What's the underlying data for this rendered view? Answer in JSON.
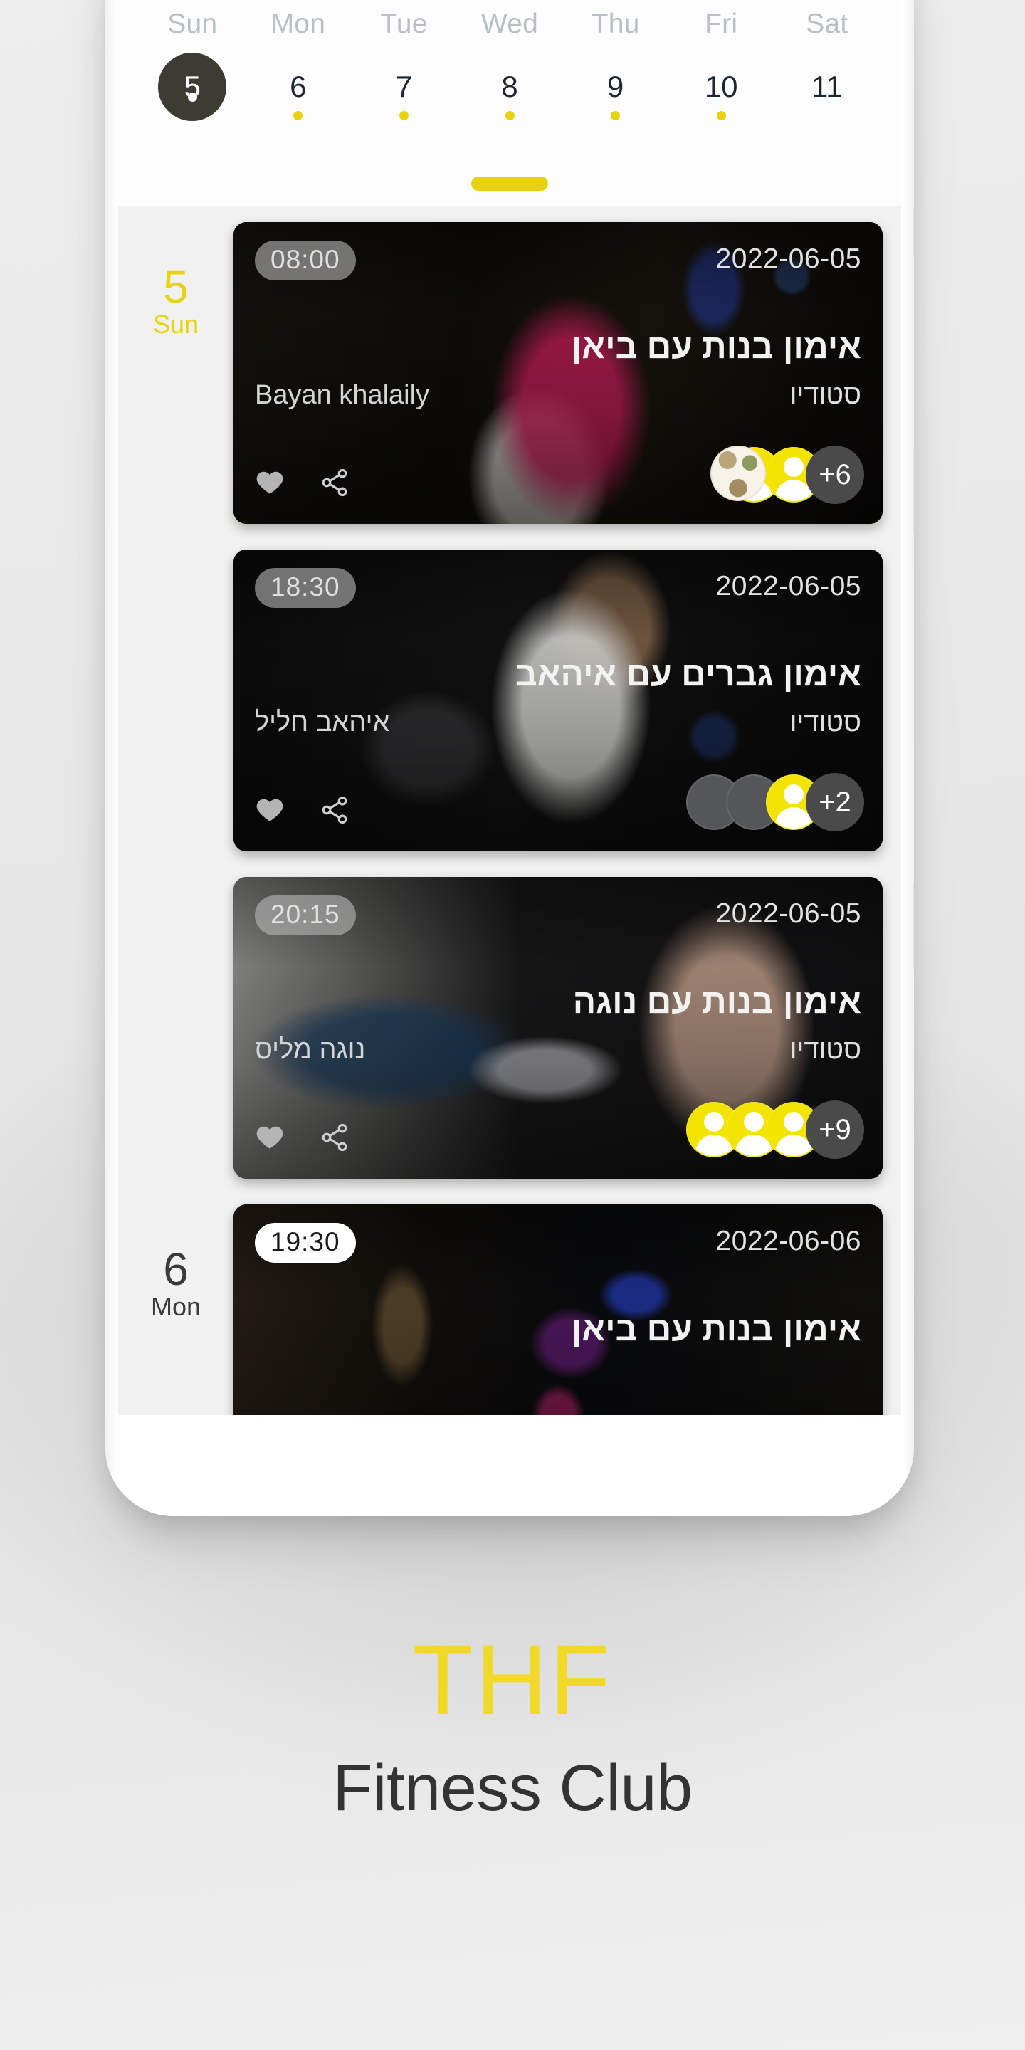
{
  "brand": {
    "logo_text": "THF",
    "tagline": "Fitness Club",
    "accent_color": "#f2d927"
  },
  "week_strip": {
    "day_names": [
      "Sun",
      "Mon",
      "Tue",
      "Wed",
      "Thu",
      "Fri",
      "Sat"
    ],
    "days": [
      {
        "num": "5",
        "dow": "Sun",
        "selected": true,
        "has_dot": true
      },
      {
        "num": "6",
        "dow": "Mon",
        "selected": false,
        "has_dot": true
      },
      {
        "num": "7",
        "dow": "Tue",
        "selected": false,
        "has_dot": true
      },
      {
        "num": "8",
        "dow": "Wed",
        "selected": false,
        "has_dot": true
      },
      {
        "num": "9",
        "dow": "Thu",
        "selected": false,
        "has_dot": true
      },
      {
        "num": "10",
        "dow": "Fri",
        "selected": false,
        "has_dot": true
      },
      {
        "num": "11",
        "dow": "Sat",
        "selected": false,
        "has_dot": false
      }
    ],
    "selected_index": 0,
    "dot_color": "#e8d20d",
    "page_indicator_color": "#e8d20d"
  },
  "agenda": {
    "groups": [
      {
        "day_num": "5",
        "day_name": "Sun",
        "marker_style": "accent",
        "classes": [
          {
            "time": "08:00",
            "time_badge_style": "translucent",
            "date": "2022-06-05",
            "title": "אימון בנות עם ביאן",
            "instructor": "Bayan khalaily",
            "location": "סטודיו",
            "liked": true,
            "overflow_count": "+6",
            "avatars": [
              "yellow",
              "yellow",
              "photo"
            ],
            "photo": "ph1"
          },
          {
            "time": "18:30",
            "time_badge_style": "translucent",
            "date": "2022-06-05",
            "title": "אימון  גברים עם איהאב",
            "instructor": "איהאב חליל",
            "location": "סטודיו",
            "liked": true,
            "overflow_count": "+2",
            "avatars": [
              "gray",
              "gray",
              "yellow"
            ],
            "photo": "ph2"
          },
          {
            "time": "20:15",
            "time_badge_style": "translucent",
            "date": "2022-06-05",
            "title": "אימון בנות עם נוגה",
            "instructor": "נוגה מליס",
            "location": "סטודיו",
            "liked": true,
            "overflow_count": "+9",
            "avatars": [
              "yellow",
              "yellow",
              "yellow"
            ],
            "photo": "ph3"
          }
        ]
      },
      {
        "day_num": "6",
        "day_name": "Mon",
        "marker_style": "dark",
        "classes": [
          {
            "time": "19:30",
            "time_badge_style": "solid-white",
            "date": "2022-06-06",
            "title": "אימון בנות עם ביאן",
            "instructor": "",
            "location": "",
            "liked": false,
            "overflow_count": "",
            "avatars": [],
            "photo": "ph4"
          }
        ]
      }
    ]
  },
  "icons": {
    "heart": "heart-icon",
    "share": "share-icon"
  }
}
